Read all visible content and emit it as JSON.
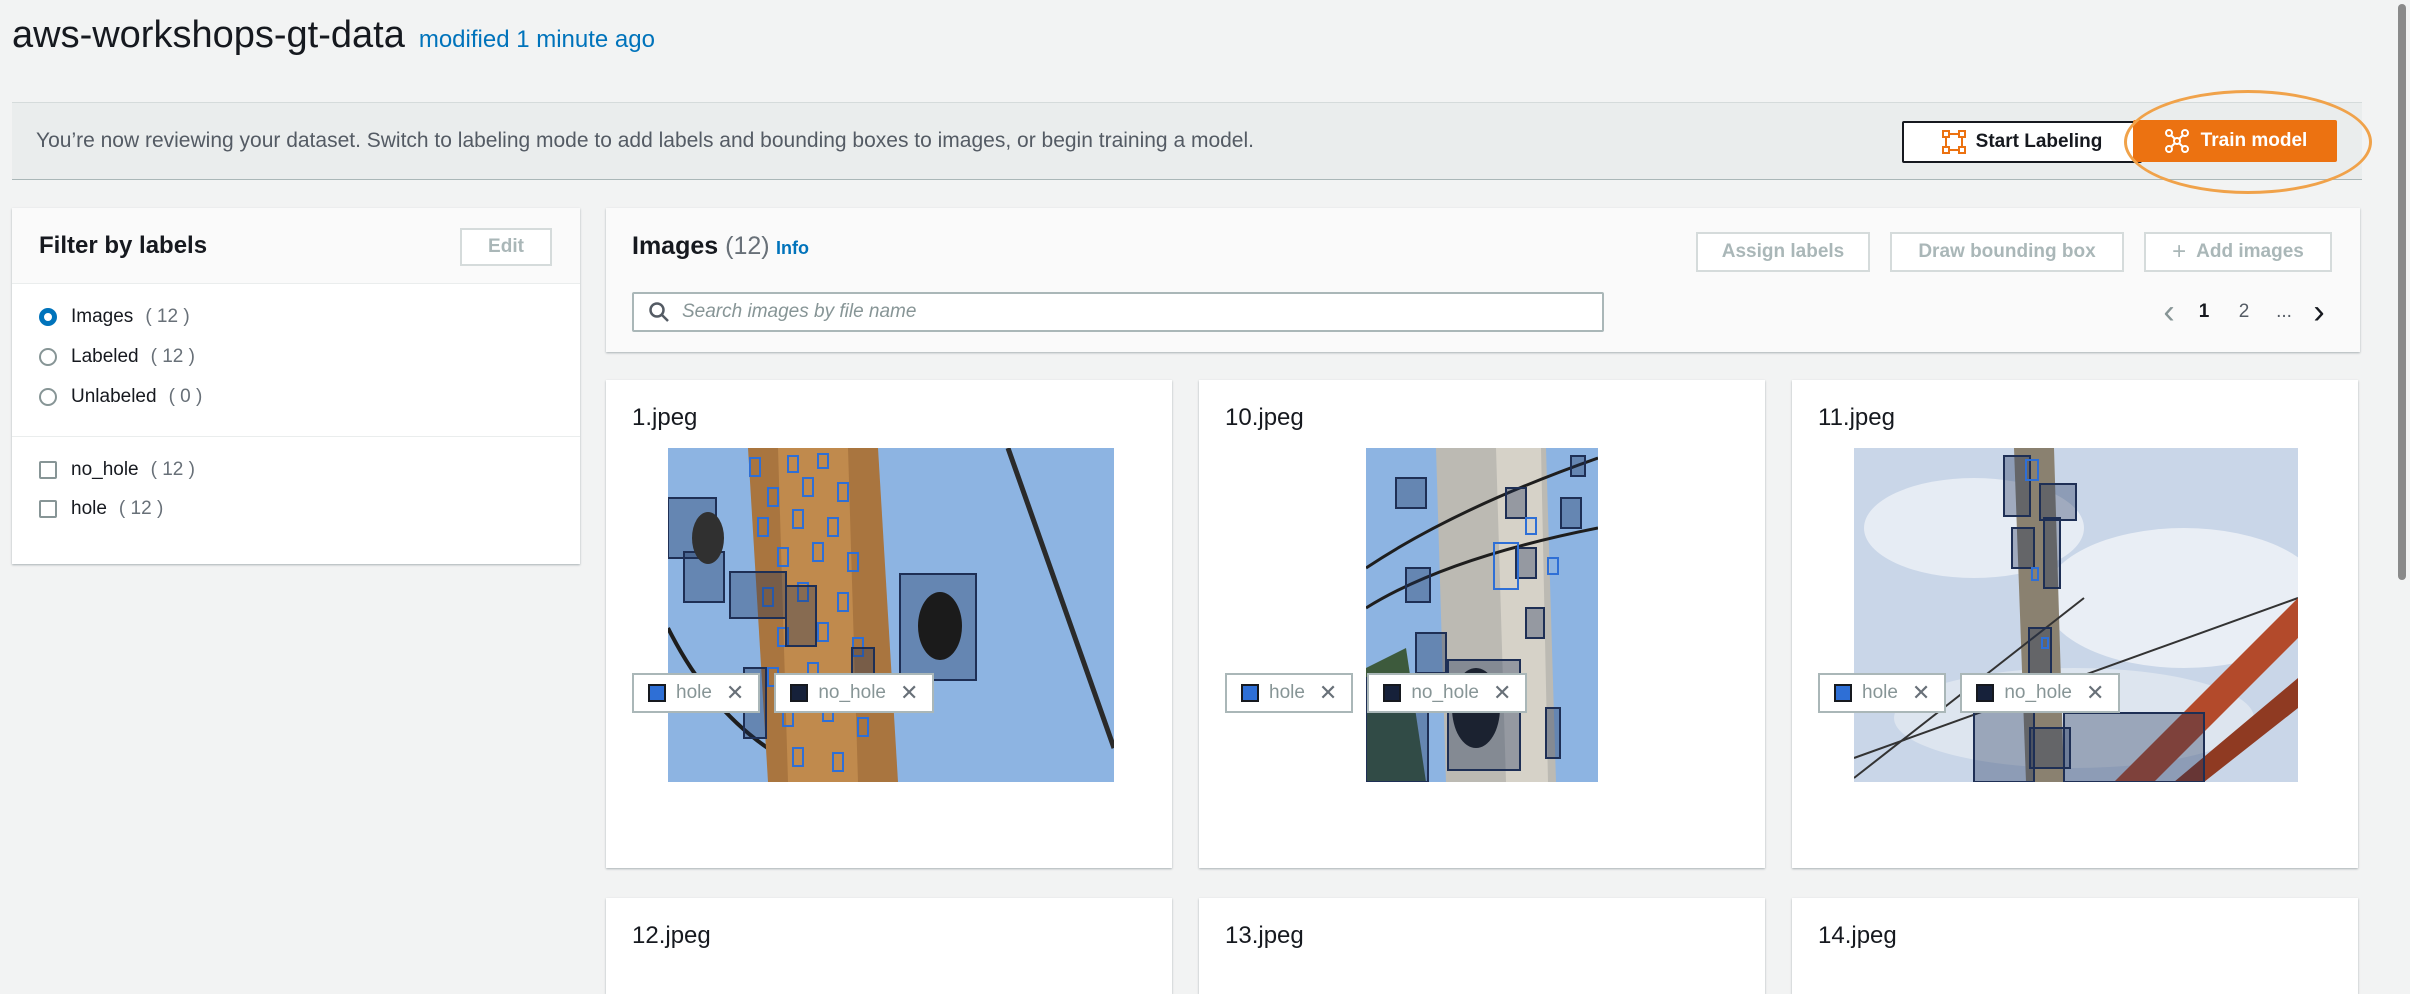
{
  "header": {
    "title": "aws-workshops-gt-data",
    "modified": "modified 1 minute ago"
  },
  "banner": {
    "text": "You’re now reviewing your dataset. Switch to labeling mode to add labels and bounding boxes to images, or begin training a model.",
    "start_labeling": "Start Labeling",
    "train_model": "Train model"
  },
  "filter": {
    "title": "Filter by labels",
    "edit": "Edit",
    "views": [
      {
        "label": "Images",
        "count": "( 12 )",
        "selected": true
      },
      {
        "label": "Labeled",
        "count": "( 12 )",
        "selected": false
      },
      {
        "label": "Unlabeled",
        "count": "( 0 )",
        "selected": false
      }
    ],
    "labels": [
      {
        "label": "no_hole",
        "count": "( 12 )"
      },
      {
        "label": "hole",
        "count": "( 12 )"
      }
    ]
  },
  "images": {
    "title": "Images",
    "count": "(12)",
    "info": "Info",
    "assign_labels": "Assign labels",
    "draw_bounding_box": "Draw bounding box",
    "add_images": "Add images",
    "search_placeholder": "Search images by file name",
    "pager": {
      "prev": "‹",
      "page1": "1",
      "page2": "2",
      "ellipsis": "...",
      "next": "›"
    }
  },
  "cards": [
    {
      "name": "1.jpeg",
      "tags": [
        "hole",
        "no_hole"
      ]
    },
    {
      "name": "10.jpeg",
      "tags": [
        "hole",
        "no_hole"
      ]
    },
    {
      "name": "11.jpeg",
      "tags": [
        "hole",
        "no_hole"
      ]
    },
    {
      "name": "12.jpeg"
    },
    {
      "name": "13.jpeg"
    },
    {
      "name": "14.jpeg"
    }
  ],
  "colors": {
    "hole": "#2e6fd6",
    "no_hole": "#16213a",
    "primary": "#ec7211",
    "link": "#0073bb"
  }
}
